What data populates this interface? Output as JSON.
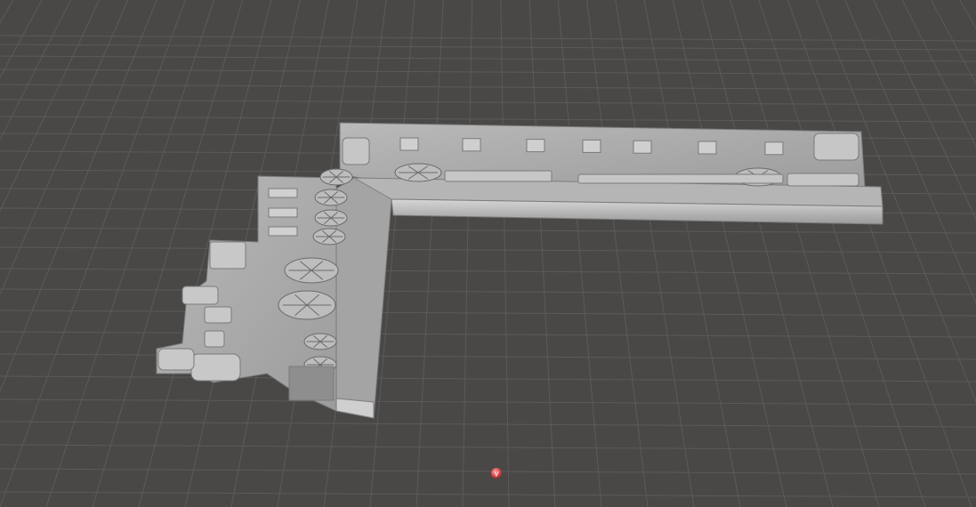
{
  "viewport": {
    "background_color": "#4a4846",
    "grid_line_color": "#5f5d5b",
    "grid_visible": true
  },
  "model": {
    "name_icon": "train-corner-frame-model",
    "surface_color": "#a9a9a9",
    "highlight_color": "#cfcfcf",
    "shadow_color": "#6f6f6f"
  },
  "pivot_marker": {
    "icon": "pivot-point-icon",
    "color": "#d94b4f"
  }
}
